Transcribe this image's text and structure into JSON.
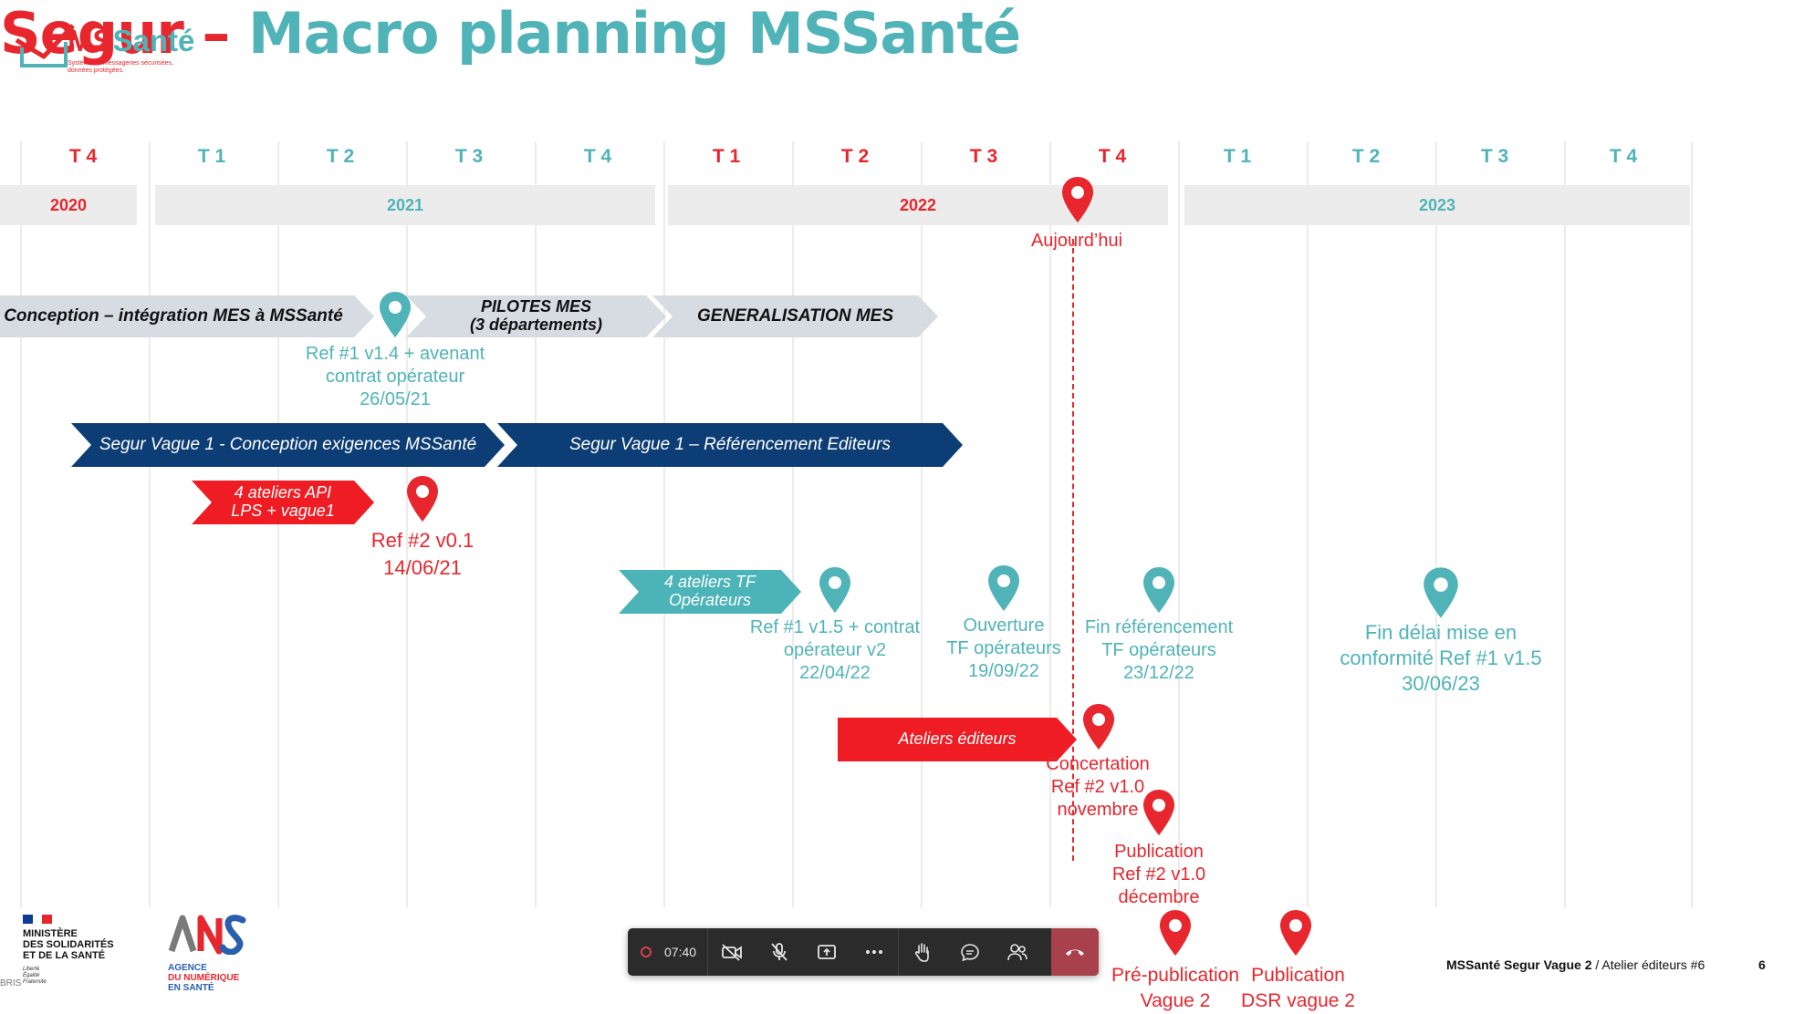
{
  "header": {
    "title_prefix": "Segur –",
    "title_main": "Macro planning MSSanté",
    "logo": {
      "name": "MSSanté",
      "tagline": "Système de messageries sécurisées, données protégées."
    }
  },
  "timeline": {
    "quarters": [
      "T 4",
      "T 1",
      "T 2",
      "T 3",
      "T 4",
      "T 1",
      "T 2",
      "T 3",
      "T 4",
      "T 1",
      "T 2",
      "T 3",
      "T 4"
    ],
    "years": [
      "2020",
      "2021",
      "2022",
      "2023"
    ],
    "today_label": "Aujourd’hui"
  },
  "phases": {
    "conception_mes": "Conception – intégration MES à MSSanté",
    "pilotes_line1": "PILOTES MES",
    "pilotes_line2": "(3 départements)",
    "generalisation": "GENERALISATION MES",
    "vague1_conception": "Segur Vague 1 - Conception exigences MSSanté",
    "vague1_referencement": "Segur Vague 1 – Référencement Editeurs",
    "ateliers_api_line1": "4 ateliers API",
    "ateliers_api_line2": "LPS + vague1",
    "ateliers_tf_line1": "4 ateliers TF",
    "ateliers_tf_line2": "Opérateurs",
    "ateliers_editeurs": "Ateliers éditeurs"
  },
  "milestones": {
    "ref1_v14": [
      "Ref #1 v1.4 + avenant",
      "contrat opérateur",
      "26/05/21"
    ],
    "ref2_v01": [
      "Ref #2 v0.1",
      "14/06/21"
    ],
    "ref1_v15": [
      "Ref #1 v1.5 + contrat",
      "opérateur v2",
      "22/04/22"
    ],
    "ouverture_tf": [
      "Ouverture",
      "TF opérateurs",
      "19/09/22"
    ],
    "fin_referencement": [
      "Fin référencement",
      "TF opérateurs",
      "23/12/22"
    ],
    "fin_delai": [
      "Fin délai mise en",
      "conformité Ref #1 v1.5",
      "30/06/23"
    ],
    "concertation": [
      "Concertation",
      "Ref #2 v1.0",
      "novembre"
    ],
    "publication_ref2": [
      "Publication",
      "Ref #2 v1.0",
      "décembre"
    ],
    "pre_publication": [
      "Pré-publication",
      "Vague 2"
    ],
    "publication_dsr": [
      "Publication",
      "DSR vague 2"
    ]
  },
  "meeting_toolbar": {
    "timer": "07:40"
  },
  "footer": {
    "ministry_lines": [
      "MINISTÈRE",
      "DES SOLIDARITÉS",
      "ET DE LA SANTÉ"
    ],
    "ministry_motto": [
      "Liberté",
      "Égalité",
      "Fraternité"
    ],
    "ans_lines": [
      "AGENCE",
      "DU NUMÉRIQUE",
      "EN SANTÉ"
    ],
    "event_bold": "MSSanté Segur Vague 2",
    "event_rest": " / Atelier éditeurs #6",
    "page_number": "6",
    "corner_text": "BRIS"
  },
  "colors": {
    "red": "#e8262d",
    "teal": "#4fb3b8",
    "navy": "#0d3d75",
    "gray_arrow": "#d7dbe2",
    "year_bar": "#ececec"
  }
}
